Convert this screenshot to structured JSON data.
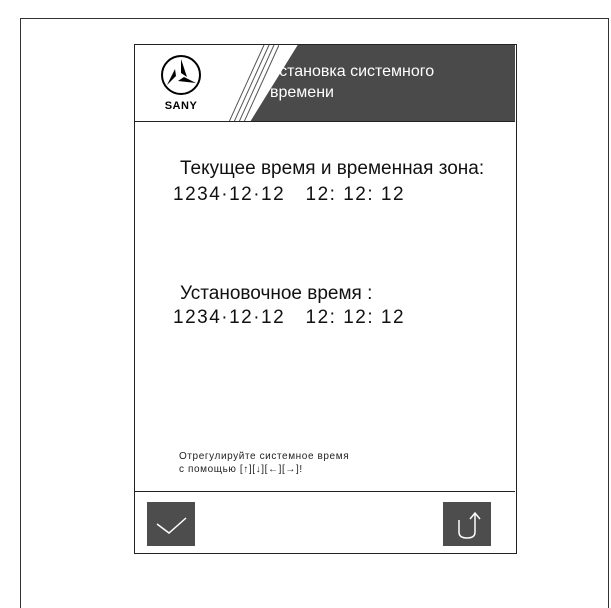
{
  "header": {
    "brand": "SANY",
    "title_line1": "Установка системного",
    "title_line2": "времени"
  },
  "current": {
    "label": "Текущее время и временная зона:",
    "value": "1234·12·12   12: 12: 12"
  },
  "setting": {
    "label": "Установочное время :",
    "value": "1234·12·12   12: 12: 12"
  },
  "hint": {
    "line1": "Отрегулируйте системное время",
    "line2": "с помощью [↑][↓][←][→]!"
  },
  "footer": {
    "confirm_icon": "checkmark-icon",
    "back_icon": "return-arrow-icon"
  },
  "colors": {
    "title_bg": "#4a4a4a",
    "button_bg": "#4d4d4d",
    "icon_stroke": "#ffffff"
  }
}
